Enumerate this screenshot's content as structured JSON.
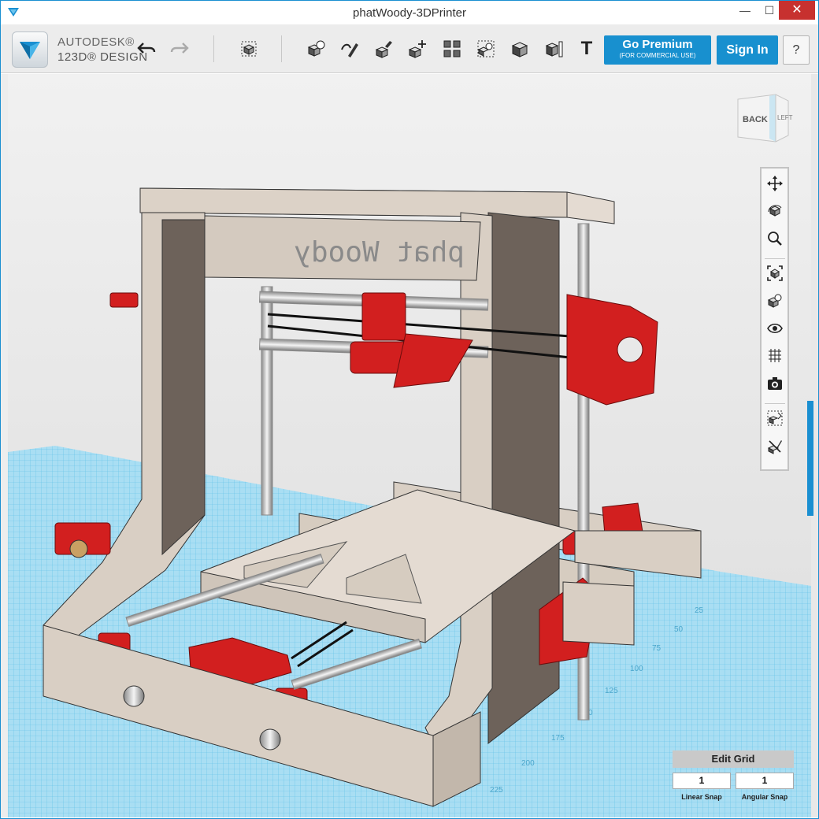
{
  "window": {
    "title": "phatWoody-3DPrinter",
    "minimize_label": "—",
    "maximize_label": "☐",
    "close_label": "✕"
  },
  "toolbar": {
    "logo_line1": "AUTODESK®",
    "logo_line2": "123D® DESIGN",
    "icons": [
      "undo-icon",
      "redo-icon",
      "transform-icon",
      "primitives-icon",
      "sketch-icon",
      "construct-icon",
      "modify-icon",
      "pattern-icon",
      "grouping-icon",
      "combine-icon",
      "measure-icon",
      "text-icon"
    ],
    "text_tool_label": "T",
    "premium_label": "Go Premium",
    "premium_sublabel": "(FOR COMMERCIAL USE)",
    "signin_label": "Sign In",
    "help_label": "?"
  },
  "viewcube": {
    "face_back": "BACK",
    "face_left": "LEFT"
  },
  "model": {
    "engraved_text": "phat Woody"
  },
  "nav_tools": [
    "pan-icon",
    "orbit-icon",
    "zoom-icon",
    "fit-icon",
    "view-icon",
    "visibility-icon",
    "grid-view-icon",
    "screenshot-icon",
    "snap-icon",
    "material-icon"
  ],
  "grid": {
    "edit_grid_label": "Edit Grid",
    "linear_snap_value": "1",
    "angular_snap_value": "1",
    "linear_snap_label": "Linear Snap",
    "angular_snap_label": "Angular Snap",
    "ruler_ticks": [
      "25",
      "50",
      "75",
      "100",
      "125",
      "150",
      "175",
      "200",
      "225"
    ]
  },
  "colors": {
    "accent": "#1890cf",
    "close": "#c7312f",
    "grid": "#8fd2ec",
    "wood": "#d9cfc4",
    "parts": "#d21f1f"
  }
}
